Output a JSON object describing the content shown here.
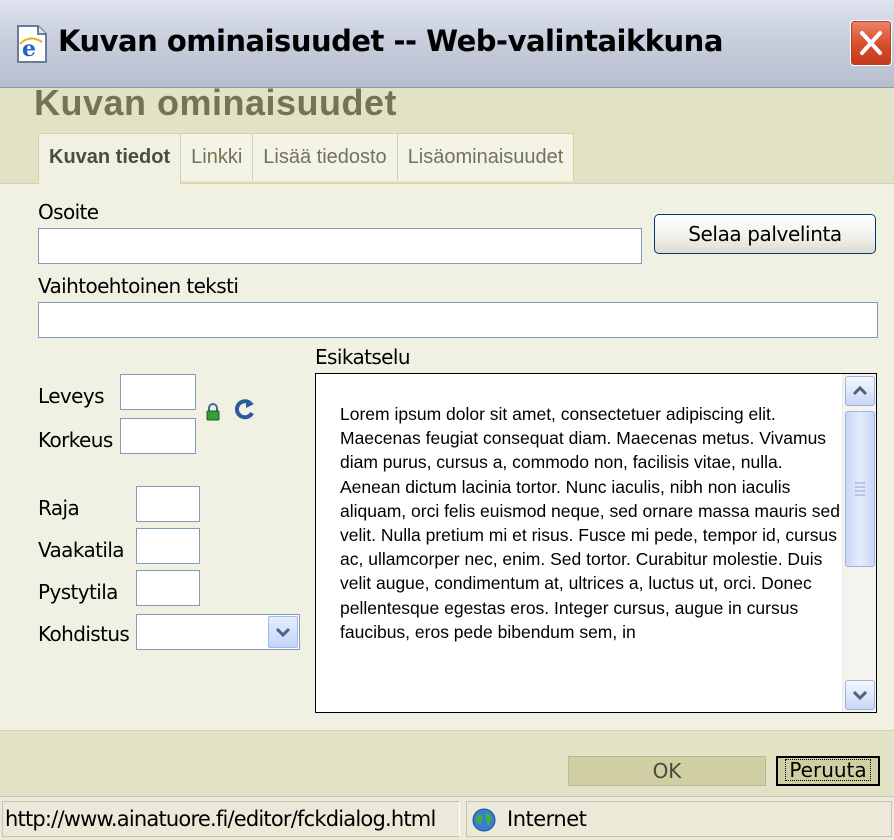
{
  "window": {
    "title": "Kuvan ominaisuudet -- Web-valintaikkuna",
    "app_icon": "ie-page-icon",
    "close_icon": "close-icon"
  },
  "dialog": {
    "title": "Kuvan ominaisuudet",
    "tabs": [
      {
        "label": "Kuvan tiedot",
        "active": true
      },
      {
        "label": "Linkki",
        "active": false
      },
      {
        "label": "Lisää tiedosto",
        "active": false
      },
      {
        "label": "Lisäominaisuudet",
        "active": false
      }
    ]
  },
  "form": {
    "url_label": "Osoite",
    "url_value": "",
    "browse_button": "Selaa palvelinta",
    "alt_label": "Vaihtoehtoinen teksti",
    "alt_value": "",
    "width_label": "Leveys",
    "width_value": "",
    "height_label": "Korkeus",
    "height_value": "",
    "border_label": "Raja",
    "border_value": "",
    "hspace_label": "Vaakatila",
    "hspace_value": "",
    "vspace_label": "Pystytila",
    "vspace_value": "",
    "align_label": "Kohdistus",
    "align_value": "",
    "preview_label": "Esikatselu",
    "preview_text": "Lorem ipsum dolor sit amet, consectetuer adipiscing elit. Maecenas feugiat consequat diam. Maecenas metus. Vivamus diam purus, cursus a, commodo non, facilisis vitae, nulla. Aenean dictum lacinia tortor. Nunc iaculis, nibh non iaculis aliquam, orci felis euismod neque, sed ornare massa mauris sed velit. Nulla pretium mi et risus. Fusce mi pede, tempor id, cursus ac, ullamcorper nec, enim. Sed tortor. Curabitur molestie. Duis velit augue, condimentum at, ultrices a, luctus ut, orci. Donec pellentesque egestas eros. Integer cursus, augue in cursus faucibus, eros pede bibendum sem, in"
  },
  "buttons": {
    "ok": "OK",
    "cancel": "Peruuta"
  },
  "statusbar": {
    "url": "http://www.ainatuore.fi/editor/fckdialog.html",
    "zone": "Internet"
  },
  "colors": {
    "header_bg": "#e2e2c7",
    "dialog_title": "#737357",
    "content_bg": "#f1f1e3",
    "button_bg": "#d0cfa4"
  }
}
